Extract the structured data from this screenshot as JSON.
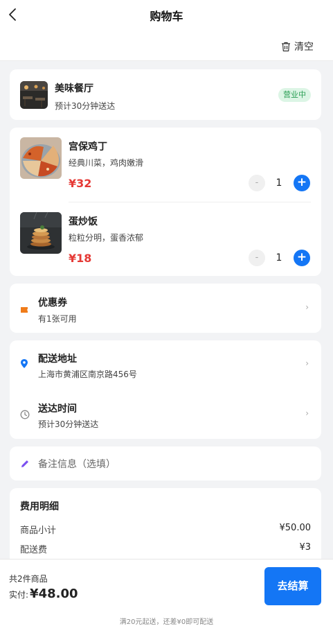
{
  "header": {
    "title": "购物车",
    "clear_label": "清空"
  },
  "shop": {
    "name": "美味餐厅",
    "subtitle": "预计30分钟送达",
    "status_badge": "营业中"
  },
  "items": [
    {
      "name": "宫保鸡丁",
      "desc": "经典川菜，鸡肉嫩滑",
      "price": "¥32",
      "minus": "-",
      "qty": "1",
      "plus": "+"
    },
    {
      "name": "蛋炒饭",
      "desc": "粒粒分明，蛋香浓郁",
      "price": "¥18",
      "minus": "-",
      "qty": "1",
      "plus": "+"
    }
  ],
  "coupon": {
    "title": "优惠券",
    "subtitle": "有1张可用",
    "chevron": "›"
  },
  "address": {
    "title": "配送地址",
    "subtitle": "上海市黄浦区南京路456号",
    "chevron": "›"
  },
  "delivery": {
    "title": "送达时间",
    "subtitle": "预计30分钟送达",
    "chevron": "›"
  },
  "note": {
    "placeholder": "备注信息（选填）"
  },
  "fees": {
    "title": "费用明细",
    "rows": [
      {
        "label": "商品小计",
        "value": "¥50.00"
      },
      {
        "label": "配送费",
        "value": "¥3"
      }
    ]
  },
  "footer": {
    "count_text": "共2件商品",
    "pay_label": "实付:",
    "pay_amount": "¥48.00",
    "checkout_label": "去结算",
    "min_order_tip": "满20元起送，还差¥0即可配送"
  },
  "colors": {
    "accent": "#1476f5",
    "price": "#e53935",
    "open_badge_bg": "#dcf5e5",
    "open_badge_text": "#2b9e55",
    "coupon_icon": "#f07c1a",
    "location_icon": "#1476f5",
    "note_icon": "#7b4ff0"
  },
  "icons": {
    "back": "chevron-left-icon",
    "clear": "trash-icon",
    "coupon": "ticket-icon",
    "address": "location-pin-icon",
    "delivery": "clock-icon",
    "note": "pencil-icon"
  }
}
